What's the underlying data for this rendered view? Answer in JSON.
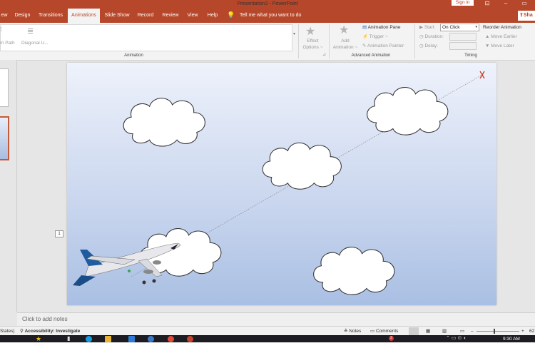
{
  "window": {
    "title": "Presentation2 - PowerPoint",
    "sign_in": "Sign in"
  },
  "tabs": [
    "ew",
    "Design",
    "Transitions",
    "Animations",
    "Slide Show",
    "Record",
    "Review",
    "View",
    "Help"
  ],
  "active_tab": "Animations",
  "tell_me": "Tell me what you want to do",
  "share": "Sha",
  "ribbon": {
    "animation_gallery": [
      "m Path",
      "Diagonal U..."
    ],
    "effect_options": "Effect\nOptions ~",
    "group_animation": "Animation",
    "add_animation": "Add\nAnimation ~",
    "animation_pane": "Animation Pane",
    "trigger": "Trigger ~",
    "animation_painter": "Animation Painter",
    "group_advanced": "Advanced Animation",
    "start_label": "Start:",
    "start_value": "On Click",
    "duration_label": "Duration:",
    "delay_label": "Delay:",
    "group_timing": "Timing",
    "reorder": "Reorder Animation",
    "move_earlier": "Move Earlier",
    "move_later": "Move Later"
  },
  "slide": {
    "animation_tag": "1"
  },
  "notes_placeholder": "Click to add notes",
  "status": {
    "left": "States)",
    "accessibility": "Accessibility: Investigate",
    "notes": "Notes",
    "comments": "Comments",
    "zoom": "62"
  },
  "taskbar": {
    "time": "9:30 AM",
    "badge": "2"
  },
  "colors": {
    "accent": "#b7472a",
    "taskbar": "#1c1c22",
    "slide_top": "#eef2fb",
    "slide_bottom": "#a9bfe3"
  }
}
